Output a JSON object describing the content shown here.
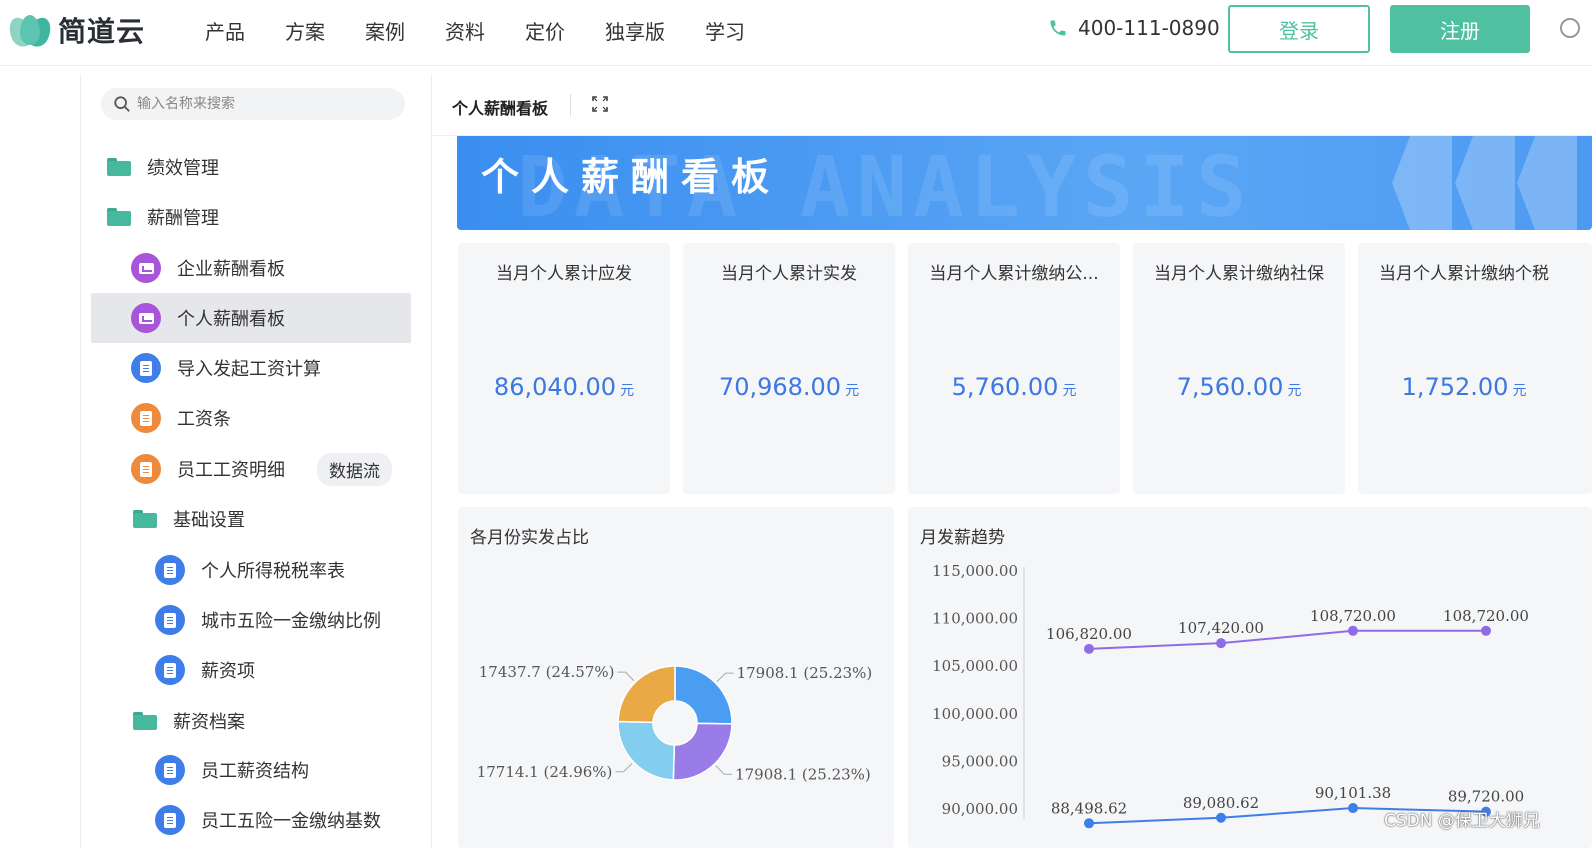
{
  "topnav": {
    "logo_text": "简道云",
    "items": [
      "产品",
      "方案",
      "案例",
      "资料",
      "定价",
      "独享版",
      "学习"
    ],
    "phone": "400-111-0890",
    "login_label": "登录",
    "register_label": "注册",
    "accent": "#4fc1a1"
  },
  "sidebar": {
    "search_placeholder": "输入名称来搜索",
    "items": [
      {
        "label": "绩效管理",
        "icon": "folder-icon"
      },
      {
        "label": "薪酬管理",
        "icon": "folder-icon"
      },
      {
        "label": "企业薪酬看板",
        "icon": "dashboard-icon"
      },
      {
        "label": "个人薪酬看板",
        "icon": "dashboard-icon",
        "active": true
      },
      {
        "label": "导入发起工资计算",
        "icon": "form-icon"
      },
      {
        "label": "工资条",
        "icon": "form-icon"
      },
      {
        "label": "员工工资明细",
        "icon": "form-icon",
        "tag": "数据流"
      },
      {
        "label": "基础设置",
        "icon": "folder-icon"
      },
      {
        "label": "个人所得税税率表",
        "icon": "form-icon"
      },
      {
        "label": "城市五险一金缴纳比例",
        "icon": "form-icon"
      },
      {
        "label": "薪资项",
        "icon": "form-icon"
      },
      {
        "label": "薪资档案",
        "icon": "folder-icon"
      },
      {
        "label": "员工薪资结构",
        "icon": "form-icon"
      },
      {
        "label": "员工五险一金缴纳基数",
        "icon": "form-icon"
      }
    ]
  },
  "tab": {
    "title": "个人薪酬看板"
  },
  "banner": {
    "title": "个人薪酬看板",
    "bg_text": "DATA ANALYSIS"
  },
  "kpis": [
    {
      "label": "当月个人累计应发",
      "value": "86,040.00",
      "unit": "元"
    },
    {
      "label": "当月个人累计实发",
      "value": "70,968.00",
      "unit": "元"
    },
    {
      "label": "当月个人累计缴纳公...",
      "value": "5,760.00",
      "unit": "元"
    },
    {
      "label": "当月个人累计缴纳社保",
      "value": "7,560.00",
      "unit": "元"
    },
    {
      "label": "当月个人累计缴纳个税",
      "value": "1,752.00",
      "unit": "元"
    }
  ],
  "chart_data": [
    {
      "type": "pie",
      "title": "各月份实发占比",
      "slices": [
        {
          "label": "17908.1 (25.23%)",
          "value": 17908.1,
          "percent": 25.23,
          "color": "#4a9df0"
        },
        {
          "label": "17908.1 (25.23%)",
          "value": 17908.1,
          "percent": 25.23,
          "color": "#9a7ce8"
        },
        {
          "label": "17714.1 (24.96%)",
          "value": 17714.1,
          "percent": 24.96,
          "color": "#83cdee"
        },
        {
          "label": "17437.7 (24.57%)",
          "value": 17437.7,
          "percent": 24.57,
          "color": "#e9a944"
        }
      ]
    },
    {
      "type": "line",
      "title": "月发薪趋势",
      "ylim": [
        90000,
        115000
      ],
      "yticks": [
        "115,000.00",
        "110,000.00",
        "105,000.00",
        "100,000.00",
        "95,000.00",
        "90,000.00"
      ],
      "series": [
        {
          "values": [
            106820,
            107420,
            108720,
            108720
          ],
          "labels": [
            "106,820.00",
            "107,420.00",
            "108,720.00",
            "108,720.00"
          ],
          "color": "#8f6ce6"
        },
        {
          "values": [
            88498.62,
            89080.62,
            90101.38,
            89720
          ],
          "labels": [
            "88,498.62",
            "89,080.62",
            "90,101.38",
            "89,720.00"
          ],
          "color": "#3f7ee8"
        }
      ]
    }
  ],
  "watermark": "CSDN @保卫大狮兄"
}
